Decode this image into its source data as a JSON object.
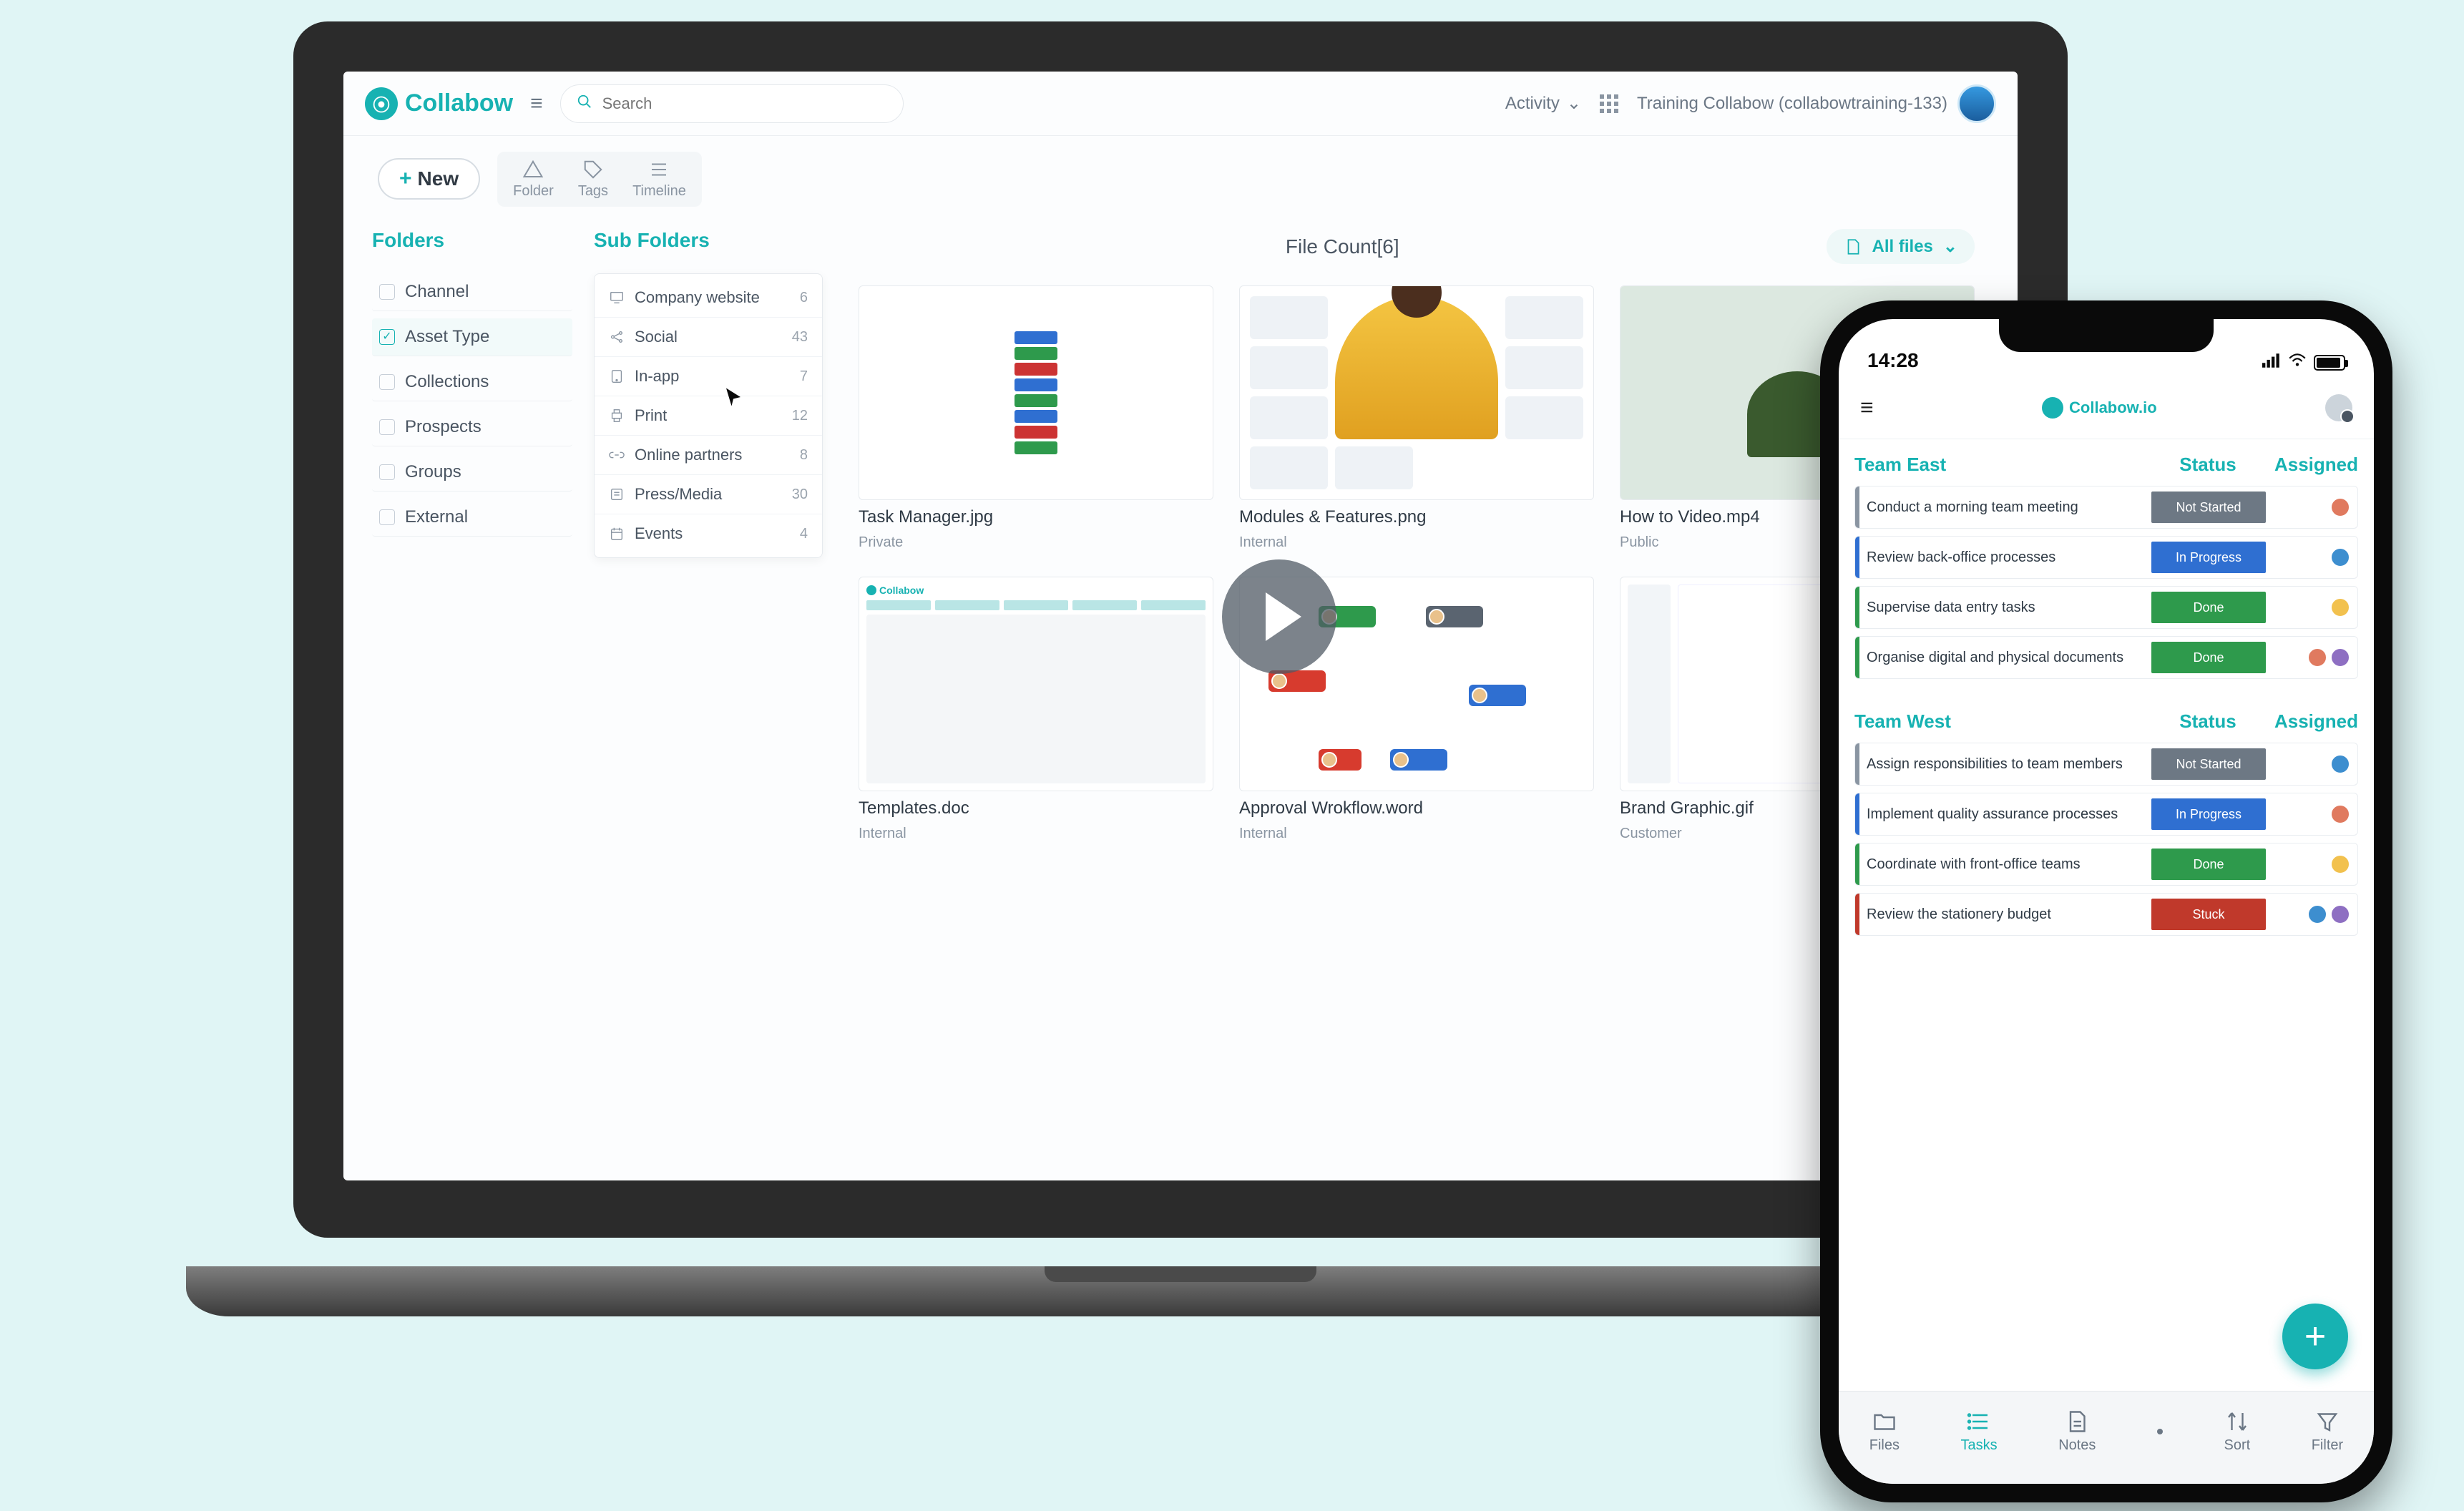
{
  "brand": {
    "app_name": "Collabow",
    "mobile_name": "Collabow.io",
    "accent": "#17b2b2"
  },
  "desktop": {
    "search_placeholder": "Search",
    "topnav": {
      "activity_label": "Activity",
      "user_name": "Training Collabow (collabowtraining-133)"
    },
    "toolbar": {
      "new_label": "New",
      "folder_label": "Folder",
      "tags_label": "Tags",
      "timeline_label": "Timeline"
    },
    "folders": {
      "title": "Folders",
      "items": [
        {
          "label": "Channel",
          "active": false
        },
        {
          "label": "Asset Type",
          "active": true
        },
        {
          "label": "Collections",
          "active": false
        },
        {
          "label": "Prospects",
          "active": false
        },
        {
          "label": "Groups",
          "active": false
        },
        {
          "label": "External",
          "active": false
        }
      ]
    },
    "subfolders": {
      "title": "Sub Folders",
      "items": [
        {
          "icon": "monitor-icon",
          "label": "Company website",
          "count": "6"
        },
        {
          "icon": "share-icon",
          "label": "Social",
          "count": "43"
        },
        {
          "icon": "app-icon",
          "label": "In-app",
          "count": "7"
        },
        {
          "icon": "print-icon",
          "label": "Print",
          "count": "12"
        },
        {
          "icon": "link-icon",
          "label": "Online partners",
          "count": "8"
        },
        {
          "icon": "news-icon",
          "label": "Press/Media",
          "count": "30"
        },
        {
          "icon": "calendar-icon",
          "label": "Events",
          "count": "4"
        }
      ]
    },
    "content": {
      "file_count_label": "File Count[6]",
      "filter_label": "All files",
      "files": [
        {
          "name": "Task Manager.jpg",
          "scope": "Private",
          "thumb": "task"
        },
        {
          "name": "Modules & Features.png",
          "scope": "Internal",
          "thumb": "modules"
        },
        {
          "name": "How to Video.mp4",
          "scope": "Public",
          "thumb": "video"
        },
        {
          "name": "Templates.doc",
          "scope": "Internal",
          "thumb": "template"
        },
        {
          "name": "Approval Wrokflow.word",
          "scope": "Internal",
          "thumb": "workflow"
        },
        {
          "name": "Brand Graphic.gif",
          "scope": "Customer",
          "thumb": "brand"
        }
      ]
    }
  },
  "mobile": {
    "status_time": "14:28",
    "columns": {
      "status": "Status",
      "assigned": "Assigned"
    },
    "teams": [
      {
        "name": "Team East",
        "tasks": [
          {
            "name": "Conduct a morning team meeting",
            "status": "Not Started",
            "status_class": "grey",
            "avs": [
              "a1"
            ]
          },
          {
            "name": "Review back-office processes",
            "status": "In Progress",
            "status_class": "blue",
            "avs": [
              "a2"
            ]
          },
          {
            "name": "Supervise data entry tasks",
            "status": "Done",
            "status_class": "green",
            "avs": [
              "a3"
            ]
          },
          {
            "name": "Organise digital and physical documents",
            "status": "Done",
            "status_class": "green",
            "avs": [
              "a1",
              "a4"
            ]
          }
        ]
      },
      {
        "name": "Team West",
        "tasks": [
          {
            "name": "Assign responsibilities to team members",
            "status": "Not Started",
            "status_class": "grey",
            "avs": [
              "a2"
            ]
          },
          {
            "name": "Implement quality assurance processes",
            "status": "In Progress",
            "status_class": "blue",
            "avs": [
              "a1"
            ]
          },
          {
            "name": "Coordinate with front-office teams",
            "status": "Done",
            "status_class": "green",
            "avs": [
              "a3"
            ]
          },
          {
            "name": "Review the stationery budget",
            "status": "Stuck",
            "status_class": "red",
            "avs": [
              "a2",
              "a4"
            ]
          }
        ]
      }
    ],
    "tabs": [
      {
        "label": "Files",
        "icon": "folder-icon"
      },
      {
        "label": "Tasks",
        "icon": "list-icon",
        "active": true
      },
      {
        "label": "Notes",
        "icon": "doc-icon"
      },
      {
        "label": "Sort",
        "icon": "sort-icon"
      },
      {
        "label": "Filter",
        "icon": "filter-icon"
      }
    ]
  }
}
